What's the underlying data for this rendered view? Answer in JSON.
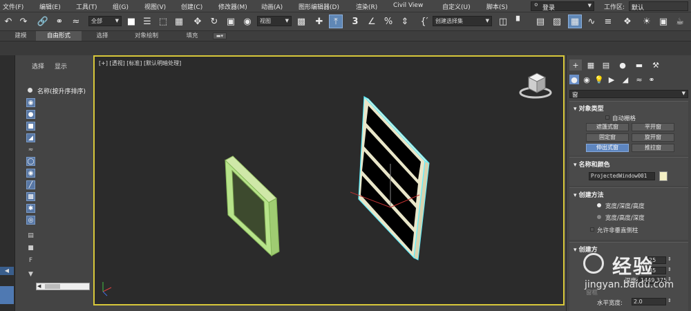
{
  "menu": [
    {
      "id": "file",
      "label": "文件(F)"
    },
    {
      "id": "edit",
      "label": "编辑(E)"
    },
    {
      "id": "tools",
      "label": "工具(T)"
    },
    {
      "id": "group",
      "label": "组(G)"
    },
    {
      "id": "view",
      "label": "视图(V)"
    },
    {
      "id": "create",
      "label": "创建(C)"
    },
    {
      "id": "modifiers",
      "label": "修改器(M)"
    },
    {
      "id": "animation",
      "label": "动画(A)"
    },
    {
      "id": "graph_editors",
      "label": "图形编辑器(D)"
    },
    {
      "id": "rendering",
      "label": "渲染(R)"
    },
    {
      "id": "civil_view",
      "label": "Civil View"
    },
    {
      "id": "customize",
      "label": "自定义(U)"
    },
    {
      "id": "scripting",
      "label": "脚本(S)"
    }
  ],
  "login": {
    "label": "登录"
  },
  "workspace": {
    "label": "工作区:",
    "value": "默认"
  },
  "toolbar": {
    "selection_filter": "全部",
    "ref_coord": "视图",
    "named_selection": "创建选择集",
    "snap_value": "3"
  },
  "ribbon_tabs": [
    {
      "id": "modeling",
      "label": "建模",
      "active": false
    },
    {
      "id": "freeform",
      "label": "自由形式",
      "active": true
    },
    {
      "id": "selection",
      "label": "选择",
      "active": false
    },
    {
      "id": "object_paint",
      "label": "对象绘制",
      "active": false
    },
    {
      "id": "populate",
      "label": "填充",
      "active": false
    }
  ],
  "scene_explorer": {
    "tab_select": "选择",
    "tab_display": "显示",
    "sort_header": "名称(按升序排序)"
  },
  "viewport": {
    "label": "[+] [透视] [标准] [默认明暗处理]"
  },
  "command_panel": {
    "category": "窗",
    "object_type": {
      "title": "对象类型",
      "autogrid": "自动栅格",
      "buttons": [
        {
          "id": "awning",
          "label": "遮篷式窗",
          "selected": false
        },
        {
          "id": "casement",
          "label": "平开窗",
          "selected": false
        },
        {
          "id": "fixed",
          "label": "固定窗",
          "selected": false
        },
        {
          "id": "pivoted",
          "label": "旋开窗",
          "selected": false
        },
        {
          "id": "projected",
          "label": "伸出式窗",
          "selected": true
        },
        {
          "id": "sliding",
          "label": "推拉窗",
          "selected": false
        }
      ]
    },
    "name_color": {
      "title": "名称和颜色",
      "name_value": "ProjectedWindow001",
      "swatch_color": "#f3efc4"
    },
    "creation_method": {
      "title": "创建方法",
      "opt1": "宽度/深度/高度",
      "opt2": "宽度/高度/深度",
      "allow_non_vertical": "允许非垂直侧柱"
    },
    "parameters": {
      "title": "创建方",
      "depth_label": "深度:",
      "depth_value": "1449.375",
      "v1_suffix": "25",
      "v2_suffix": "85",
      "frame_title": "窗框",
      "horiz_label": "水平宽度:",
      "horiz_value": "2.0"
    }
  },
  "watermark": {
    "line1": "经验",
    "line2": "jingyan.baidu.com"
  },
  "colors": {
    "viewport_border": "#d8c83a",
    "selected_button": "#5d85bf",
    "window_frame": "#e9e6c9",
    "selected_outline": "#5ef0ff",
    "green_window": "#b7e38a"
  }
}
